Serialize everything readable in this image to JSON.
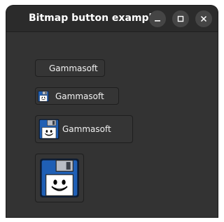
{
  "window": {
    "title": "Bitmap button example",
    "controls": {
      "minimize": "minimize-icon",
      "maximize": "maximize-icon",
      "close": "close-icon"
    }
  },
  "buttons": {
    "text_only_label": "Gammasoft",
    "small_icon_label": "Gammasoft",
    "medium_icon_label": "Gammasoft",
    "large_icon_label": ""
  },
  "colors": {
    "window_bg": "#333333",
    "titlebar_bg": "#2b2b2b",
    "button_bg": "#353535",
    "text": "#f2f2f2",
    "floppy_blue": "#1f5fb5"
  }
}
